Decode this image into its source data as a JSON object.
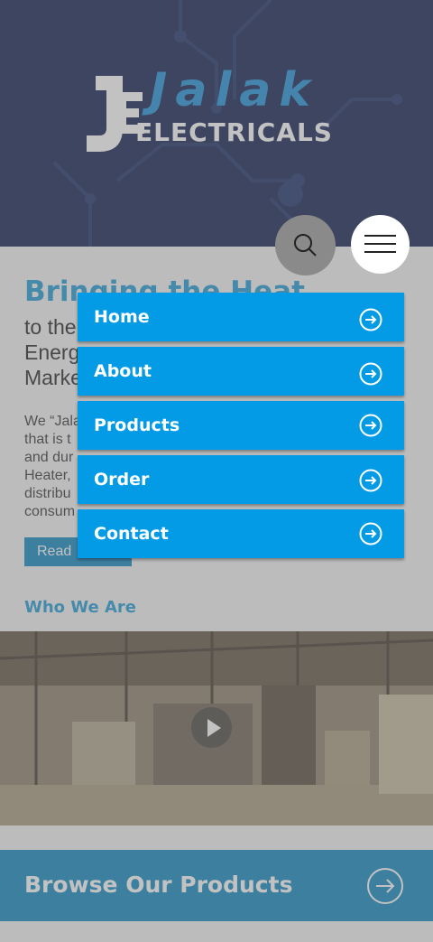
{
  "brand": {
    "logo_text_top": "Jalak",
    "logo_text_bottom": "ELECTRICALS",
    "colors": {
      "navy": "#0e1c4e",
      "accent": "#039be5",
      "link_blue": "#1e9ad6"
    }
  },
  "header": {
    "search_icon": "search-icon",
    "menu_icon": "hamburger-icon"
  },
  "menu": {
    "items": [
      {
        "label": "Home",
        "icon": "arrow-circle-right-icon"
      },
      {
        "label": "About",
        "icon": "arrow-circle-right-icon"
      },
      {
        "label": "Products",
        "icon": "arrow-circle-right-icon"
      },
      {
        "label": "Order",
        "icon": "arrow-circle-right-icon"
      },
      {
        "label": "Contact",
        "icon": "arrow-circle-right-icon"
      }
    ]
  },
  "intro": {
    "headline": "Bringing the Heat",
    "subheadline": "to the\nEnerg\nMarke",
    "paragraph": "We “Jala\nthat is t\nand dur\nHeater,\ndistribu\nconsum",
    "read_more": "Read"
  },
  "who_we_are": {
    "title": "Who We Are",
    "video_icon": "play-icon"
  },
  "browse": {
    "label": "Browse Our Products",
    "icon": "arrow-circle-right-icon"
  }
}
